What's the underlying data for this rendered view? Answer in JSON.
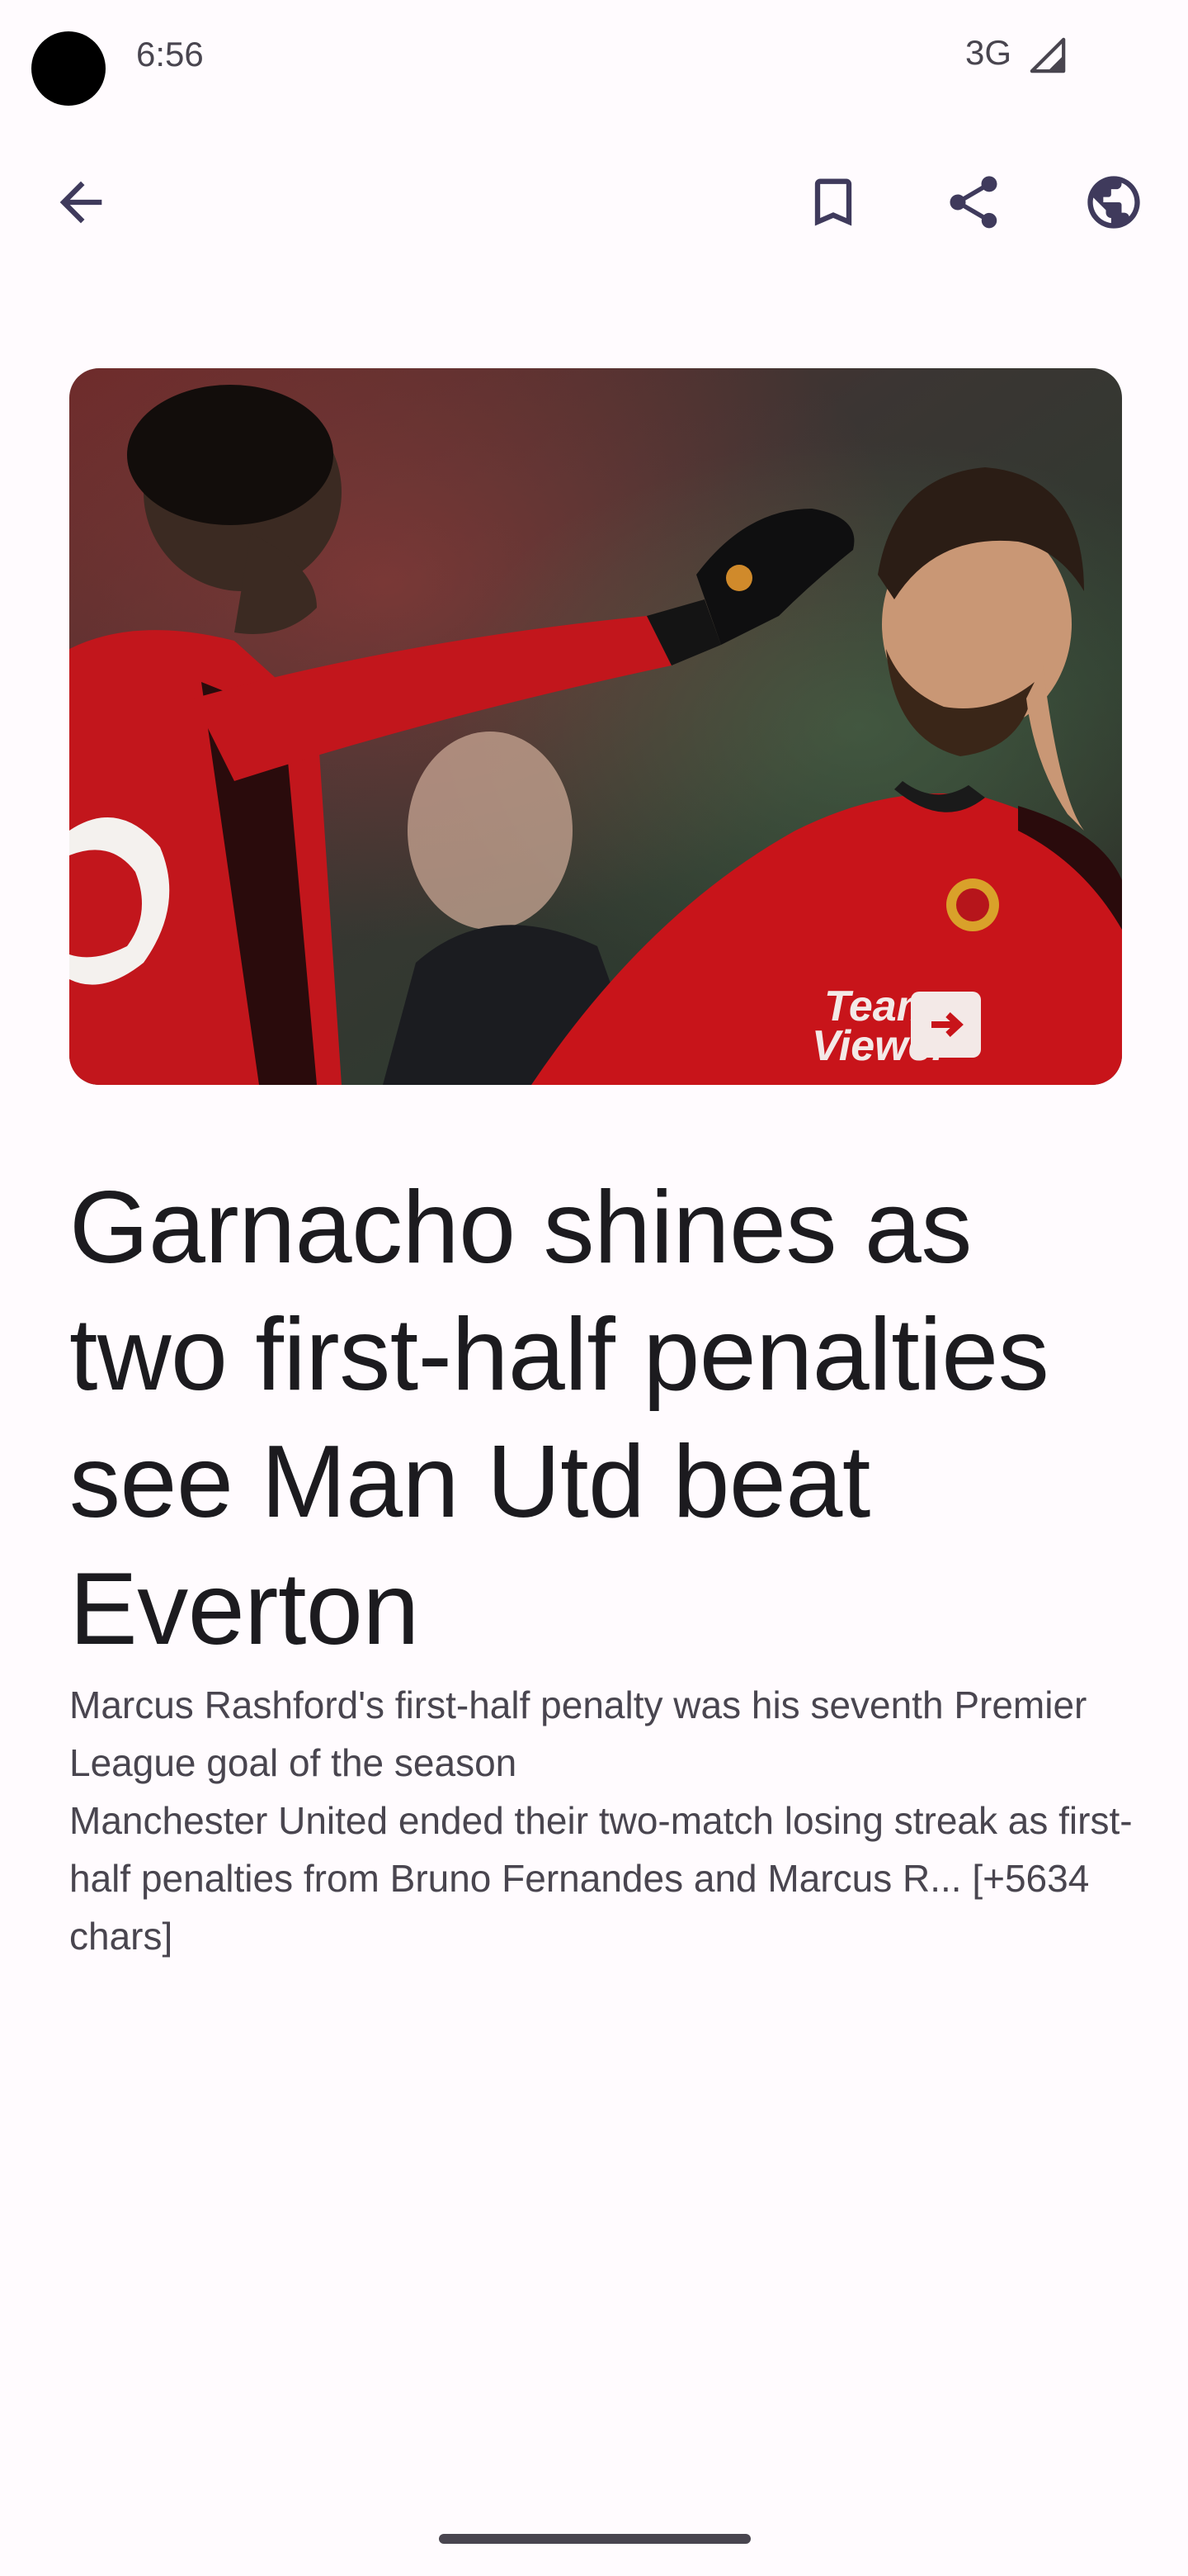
{
  "status_bar": {
    "time": "6:56",
    "network": "3G"
  },
  "app_bar": {
    "back_icon": "arrow-back-icon",
    "bookmark_icon": "bookmark-outline-icon",
    "share_icon": "share-icon",
    "web_icon": "globe-icon"
  },
  "hero_image": {
    "description_icon": "article-photo",
    "shirt_sponsor": "Team\nViewer"
  },
  "article": {
    "headline": "Garnacho shines as two first-half penalties see Man Utd beat Everton",
    "summary": "Marcus Rashford's first-half penalty was his seventh Premier League goal of the season\nManchester United ended their two-match losing streak as first-half penalties from Bruno Fernandes and Marcus R... [+5634 chars]"
  },
  "colors": {
    "background": "#fffbfe",
    "on_surface": "#1c1b1f",
    "on_surface_variant": "#49454f",
    "icon_tint": "#3f3a5c"
  }
}
